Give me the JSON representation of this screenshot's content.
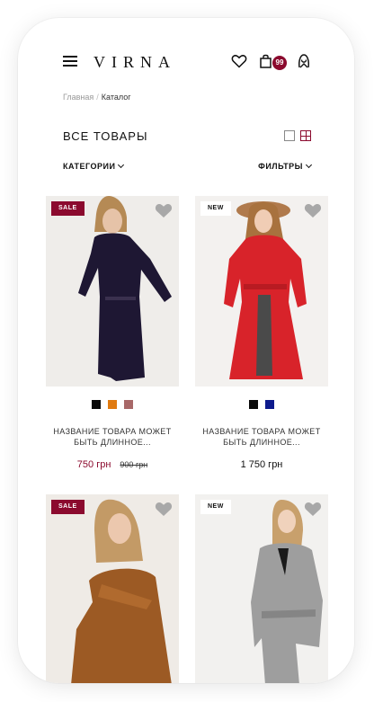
{
  "header": {
    "logo": "VIRNA",
    "cart_count": "99"
  },
  "breadcrumb": {
    "home": "Главная",
    "separator": "/",
    "current": "Каталог"
  },
  "catalog": {
    "title": "ВСЕ ТОВАРЫ",
    "categories_label": "КАТЕГОРИИ",
    "filters_label": "ФИЛЬТРЫ"
  },
  "colors": {
    "accent": "#8b0a2e"
  },
  "products": [
    {
      "badge": "SALE",
      "name": "НАЗВАНИЕ ТОВАРА МОЖЕТ БЫТЬ ДЛИННОЕ...",
      "price": "750 грн",
      "old_price": "900 грн",
      "swatches": [
        "#0a0a0a",
        "#e07a10",
        "#a86868"
      ]
    },
    {
      "badge": "NEW",
      "name": "НАЗВАНИЕ ТОВАРА МОЖЕТ БЫТЬ ДЛИННОЕ...",
      "price": "1 750 грн",
      "old_price": "",
      "swatches": [
        "#0a0a0a",
        "#0d1a8c"
      ]
    },
    {
      "badge": "SALE"
    },
    {
      "badge": "NEW"
    }
  ]
}
